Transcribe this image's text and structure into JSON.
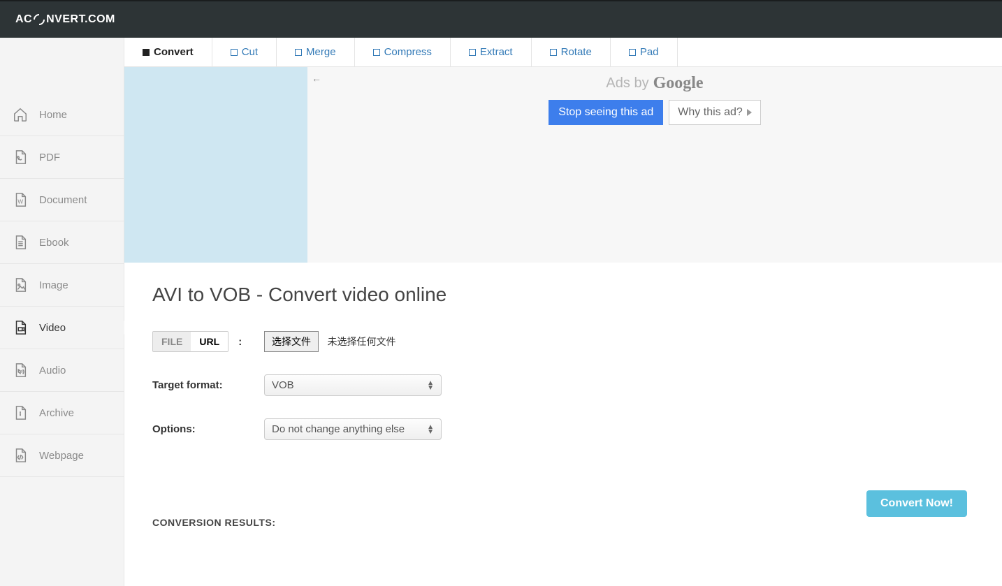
{
  "logo": {
    "prefix": "AC",
    "suffix": "NVERT.COM"
  },
  "sidebar": {
    "items": [
      {
        "label": "Home"
      },
      {
        "label": "PDF"
      },
      {
        "label": "Document"
      },
      {
        "label": "Ebook"
      },
      {
        "label": "Image"
      },
      {
        "label": "Video"
      },
      {
        "label": "Audio"
      },
      {
        "label": "Archive"
      },
      {
        "label": "Webpage"
      }
    ]
  },
  "tabs": [
    {
      "label": "Convert"
    },
    {
      "label": "Cut"
    },
    {
      "label": "Merge"
    },
    {
      "label": "Compress"
    },
    {
      "label": "Extract"
    },
    {
      "label": "Rotate"
    },
    {
      "label": "Pad"
    }
  ],
  "ads": {
    "by_text": "Ads by",
    "by_brand": "Google",
    "stop": "Stop seeing this ad",
    "why": "Why this ad?"
  },
  "page": {
    "title": "AVI to VOB - Convert video online"
  },
  "source": {
    "file_tab": "FILE",
    "url_tab": "URL",
    "choose_btn": "选择文件",
    "no_file": "未选择任何文件"
  },
  "target": {
    "label": "Target format:",
    "value": "VOB"
  },
  "options": {
    "label": "Options:",
    "value": "Do not change anything else"
  },
  "actions": {
    "convert": "Convert Now!"
  },
  "results": {
    "heading": "CONVERSION RESULTS:"
  }
}
